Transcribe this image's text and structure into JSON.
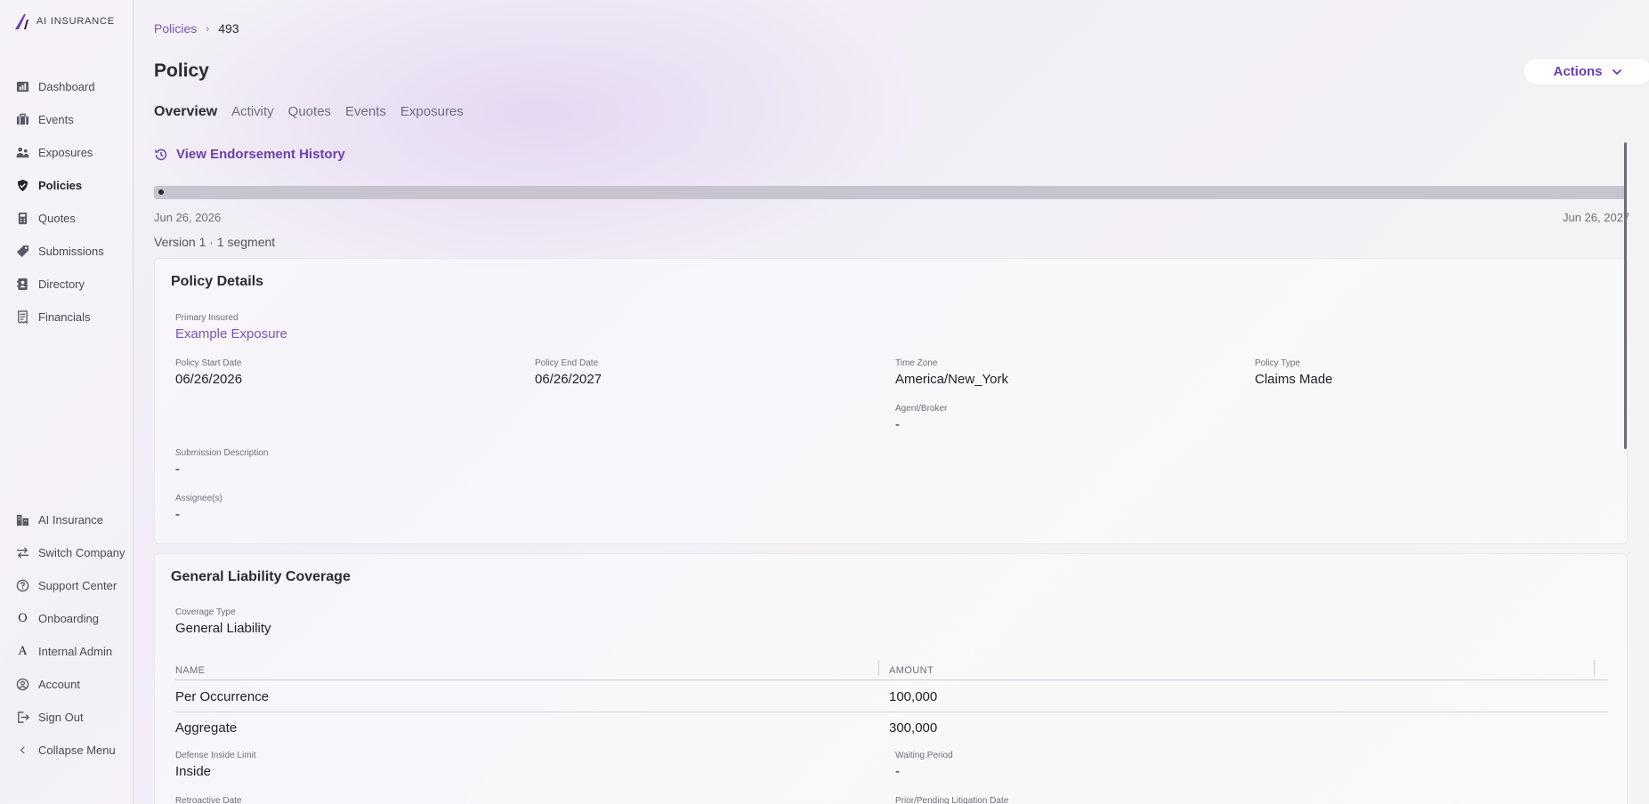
{
  "app": {
    "logo_text": "AI INSURANCE"
  },
  "sidebar": {
    "top_items": [
      {
        "label": "Dashboard",
        "icon": "dashboard-icon"
      },
      {
        "label": "Events",
        "icon": "briefcase-icon"
      },
      {
        "label": "Exposures",
        "icon": "people-icon"
      },
      {
        "label": "Policies",
        "icon": "shield-check-icon",
        "active": true
      },
      {
        "label": "Quotes",
        "icon": "calculator-icon"
      },
      {
        "label": "Submissions",
        "icon": "tag-icon"
      },
      {
        "label": "Directory",
        "icon": "address-book-icon"
      },
      {
        "label": "Financials",
        "icon": "receipt-icon"
      }
    ],
    "bottom_items": [
      {
        "label": "AI Insurance",
        "icon": "building-icon"
      },
      {
        "label": "Switch Company",
        "icon": "switch-arrows-icon"
      },
      {
        "label": "Support Center",
        "icon": "question-circle-icon"
      },
      {
        "label": "Onboarding",
        "icon": "letter-o-icon",
        "glyph": "O"
      },
      {
        "label": "Internal Admin",
        "icon": "letter-a-icon",
        "glyph": "A"
      },
      {
        "label": "Account",
        "icon": "user-circle-icon"
      },
      {
        "label": "Sign Out",
        "icon": "sign-out-icon"
      },
      {
        "label": "Collapse Menu",
        "icon": "chevron-left-icon"
      }
    ]
  },
  "breadcrumb": {
    "parent": "Policies",
    "separator": "›",
    "current": "493"
  },
  "header": {
    "title": "Policy",
    "actions_label": "Actions"
  },
  "tabs": [
    {
      "label": "Overview",
      "active": true
    },
    {
      "label": "Activity"
    },
    {
      "label": "Quotes"
    },
    {
      "label": "Events"
    },
    {
      "label": "Exposures"
    }
  ],
  "endorsement": {
    "label": "View Endorsement History"
  },
  "timeline": {
    "start": "Jun 26, 2026",
    "end": "Jun 26, 2027",
    "version_text": "Version 1 · 1 segment"
  },
  "policy_details": {
    "title": "Policy Details",
    "primary_insured_label": "Primary Insured",
    "primary_insured": "Example Exposure",
    "start_label": "Policy Start Date",
    "start": "06/26/2026",
    "end_label": "Policy End Date",
    "end": "06/26/2027",
    "tz_label": "Time Zone",
    "tz": "America/New_York",
    "type_label": "Policy Type",
    "type": "Claims Made",
    "agent_label": "Agent/Broker",
    "agent": "-",
    "submission_desc_label": "Submission Description",
    "submission_desc": "-",
    "assignees_label": "Assignee(s)",
    "assignees": "-"
  },
  "coverage": {
    "title": "General Liability Coverage",
    "coverage_type_label": "Coverage Type",
    "coverage_type": "General Liability",
    "columns": [
      "NAME",
      "AMOUNT"
    ],
    "rows": [
      {
        "name": "Per Occurrence",
        "amount": "100,000"
      },
      {
        "name": "Aggregate",
        "amount": "300,000"
      }
    ],
    "defense_label": "Defense Inside Limit",
    "defense": "Inside",
    "waiting_label": "Waiting Period",
    "waiting": "-",
    "retro_label": "Retroactive Date",
    "prior_label": "Prior/Pending Litigation Date"
  },
  "colors": {
    "accent": "#6a3fb0",
    "link": "#7a55b8"
  }
}
